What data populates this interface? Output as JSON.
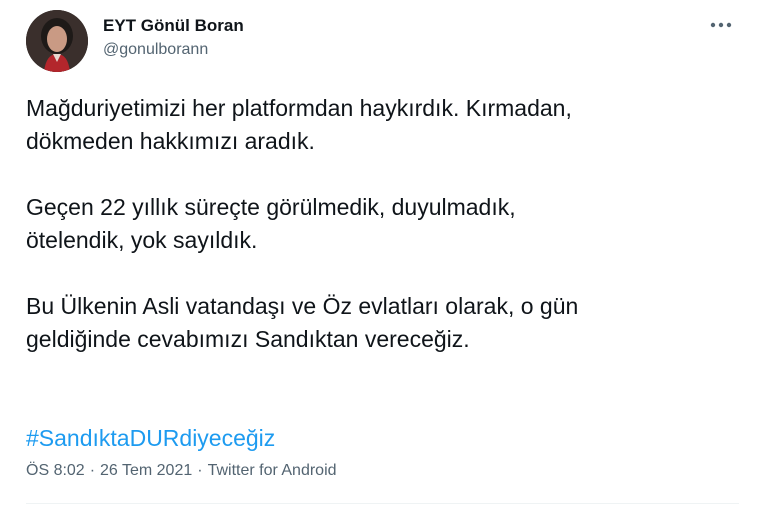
{
  "author": {
    "name": "EYT Gönül Boran",
    "handle": "@gonulborann"
  },
  "more_icon": "more-horizontal-icon",
  "text": {
    "p1": "Mağduriyetimizi her platformdan haykırdık. Kırmadan,\ndökmeden hakkımızı aradık.",
    "p2": "Geçen 22 yıllık süreçte görülmedik, duyulmadık,\nötelendik, yok sayıldık.",
    "p3": "Bu Ülkenin Asli vatandaşı ve Öz evlatları olarak, o gün\ngeldiğinde cevabımızı Sandıktan vereceğiz.",
    "hashtag": "#SandıktaDURdiyeceğiz"
  },
  "meta": {
    "time": "ÖS 8:02",
    "separator": "·",
    "date": "26 Tem 2021",
    "source": "Twitter for Android"
  },
  "colors": {
    "link": "#1d9bf0",
    "secondary_text": "#536471",
    "primary_text": "#0f1419"
  }
}
